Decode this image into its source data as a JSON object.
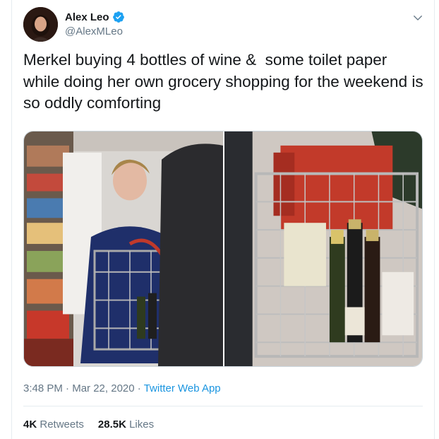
{
  "tweet": {
    "author": {
      "display_name": "Alex Leo",
      "handle": "@AlexMLeo",
      "verified_icon": "verified-badge-icon",
      "avatar_icon": "profile-avatar"
    },
    "menu_icon": "chevron-down-icon",
    "text": "Merkel buying 4 bottles of wine &  some toilet paper while doing her own grocery shopping for the weekend is so oddly comforting",
    "media": {
      "photos": [
        {
          "icon": "supermarket-photo-left"
        },
        {
          "icon": "shopping-cart-closeup-photo"
        }
      ]
    },
    "timestamp": {
      "time": "3:48 PM",
      "separator": "·",
      "date": "Mar 22, 2020",
      "app": "Twitter Web App"
    },
    "stats": {
      "retweets_count": "4K",
      "retweets_label": "Retweets",
      "likes_count": "28.5K",
      "likes_label": "Likes"
    }
  },
  "colors": {
    "text_primary": "#14171a",
    "text_secondary": "#657786",
    "link": "#1b95e0",
    "verified": "#1da1f2",
    "border": "#e6ecf0"
  }
}
